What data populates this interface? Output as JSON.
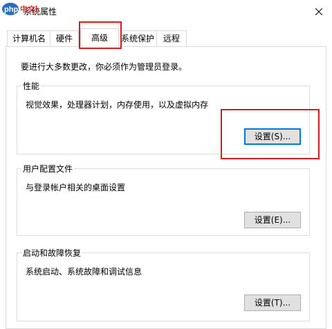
{
  "window": {
    "title": "系统属性",
    "watermark": "php 中文网"
  },
  "tabs": [
    {
      "label": "计算机名"
    },
    {
      "label": "硬件"
    },
    {
      "label": "高级",
      "active": true
    },
    {
      "label": "系统保护"
    },
    {
      "label": "远程"
    }
  ],
  "notice": "要进行大多数更改，你必须作为管理员登录。",
  "performance": {
    "caption": "性能",
    "description": "视觉效果，处理器计划，内存使用，以及虚拟内存",
    "button": "设置(S)..."
  },
  "user_profiles": {
    "caption": "用户配置文件",
    "description": "与登录帐户相关的桌面设置",
    "button": "设置(E)..."
  },
  "startup_recovery": {
    "caption": "启动和故障恢复",
    "description": "系统启动、系统故障和调试信息",
    "button": "设置(T)..."
  },
  "colors": {
    "highlight": "#d91a1a",
    "focus": "#0078d7",
    "logo_blue": "#2a6ebb",
    "logo_red": "#e03030"
  }
}
